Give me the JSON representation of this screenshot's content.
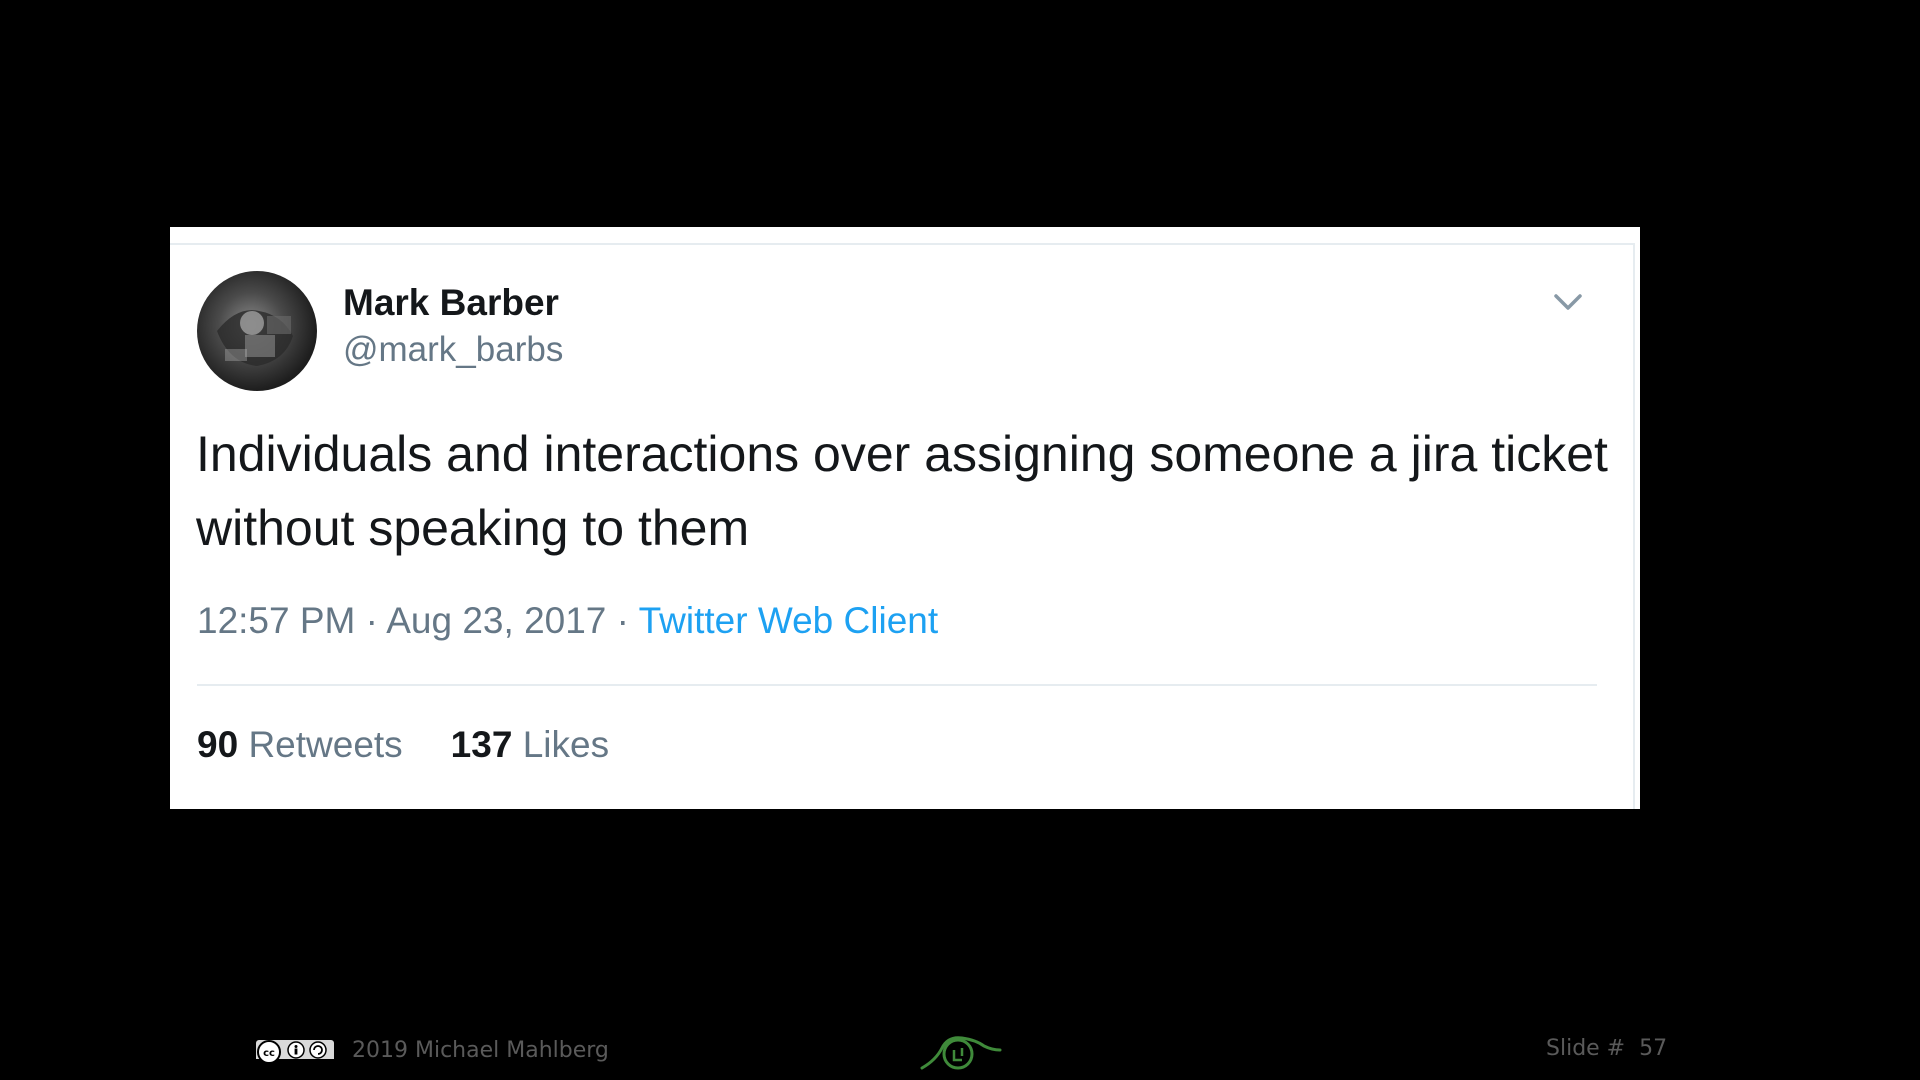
{
  "tweet": {
    "author_name": "Mark Barber",
    "author_handle": "@mark_barbs",
    "text": "Individuals and interactions over assigning someone a jira ticket without speaking to them",
    "time": "12:57 PM",
    "date": "Aug 23, 2017",
    "separator": "·",
    "source": "Twitter Web Client",
    "retweets_count": "90",
    "retweets_label": "Retweets",
    "likes_count": "137",
    "likes_label": "Likes",
    "menu_icon": "chevron-down-icon",
    "avatar_icon": "avatar"
  },
  "footer": {
    "license_icon": "cc-by-sa-icon",
    "copyright": "2019 Michael Mahlberg",
    "logo_icon": "company-logo-icon",
    "slide_label": "Slide #",
    "slide_number": "57"
  },
  "colors": {
    "background": "#000000",
    "card": "#ffffff",
    "text_primary": "#14171a",
    "text_secondary": "#657786",
    "link": "#1da1f2",
    "footer_text": "#5a5a5a",
    "logo_green": "#3f8a3a"
  }
}
